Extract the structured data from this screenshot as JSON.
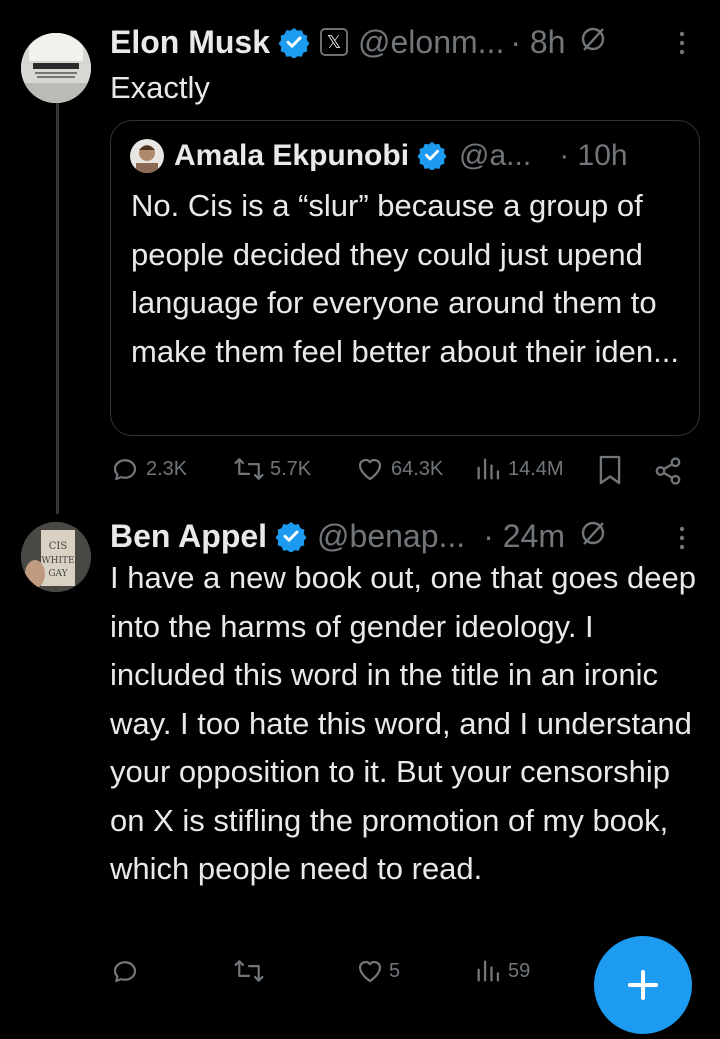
{
  "tweets": [
    {
      "name": "Elon Musk",
      "handle": "@elonm...",
      "time": "· 8h",
      "text": "Exactly",
      "quote": {
        "name": "Amala Ekpunobi",
        "handle": "@a...",
        "time": "· 10h",
        "text": "No. Cis is a “slur” because a group of people decided they could just upend language for everyone around them to make them feel better about their iden..."
      },
      "stats": {
        "replies": "2.3K",
        "reposts": "5.7K",
        "likes": "64.3K",
        "views": "14.4M"
      }
    },
    {
      "name": "Ben Appel",
      "handle": "@benap...",
      "time": "· 24m",
      "avatar_text": "CIS WHITE GAY",
      "text": "I have a new book out, one that goes deep into the harms of gender ideology. I included this word in the title in an ironic way. I too hate this word, and I understand your opposition to it. But your censorship on X is stifling the promotion of my book, which people need to read.",
      "stats": {
        "replies": "",
        "reposts": "",
        "likes": "5",
        "views": "59"
      }
    }
  ],
  "colors": {
    "accent": "#1d9bf0",
    "muted": "#71767b",
    "text": "#e7e9ea",
    "background": "#000000"
  },
  "icons": [
    "verified-icon",
    "x-badge-icon",
    "grok-icon",
    "more-icon",
    "reply-icon",
    "repost-icon",
    "like-icon",
    "views-icon",
    "bookmark-icon",
    "share-icon",
    "compose-icon"
  ]
}
